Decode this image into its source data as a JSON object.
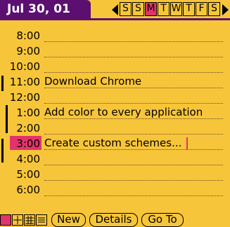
{
  "header": {
    "date": "Jul 30, 01",
    "days": [
      "S",
      "S",
      "M",
      "T",
      "W",
      "T",
      "F",
      "S"
    ],
    "selected_day_index": 2
  },
  "schedule": {
    "rows": [
      {
        "time": "8:00",
        "event": ""
      },
      {
        "time": "9:00",
        "event": ""
      },
      {
        "time": "10:00",
        "event": ""
      },
      {
        "time": "11:00",
        "event": "Download Chrome"
      },
      {
        "time": "12:00",
        "event": ""
      },
      {
        "time": "1:00",
        "event": "Add color to every application"
      },
      {
        "time": "2:00",
        "event": ""
      },
      {
        "time": "3:00",
        "event": "Create custom schemes..."
      },
      {
        "time": "4:00",
        "event": ""
      },
      {
        "time": "5:00",
        "event": ""
      },
      {
        "time": "6:00",
        "event": ""
      }
    ]
  },
  "toolbar": {
    "new_label": "New",
    "details_label": "Details",
    "goto_label": "Go To"
  },
  "colors": {
    "background": "#f7c539",
    "title_bar": "#5b1071",
    "accent": "#e2346a"
  },
  "icons": [
    "left-arrow-icon",
    "right-arrow-icon",
    "day-view-icon",
    "week-view-icon",
    "month-view-icon",
    "agenda-view-icon"
  ]
}
